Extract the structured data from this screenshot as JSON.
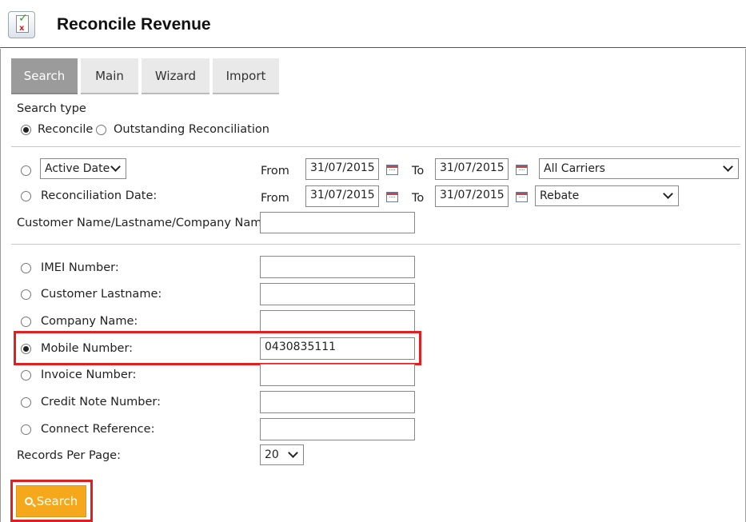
{
  "header": {
    "title": "Reconcile Revenue"
  },
  "tabs": [
    {
      "label": "Search",
      "active": true
    },
    {
      "label": "Main",
      "active": false
    },
    {
      "label": "Wizard",
      "active": false
    },
    {
      "label": "Import",
      "active": false
    }
  ],
  "search_type": {
    "label": "Search type",
    "options": [
      {
        "label": "Reconcile",
        "checked": true
      },
      {
        "label": "Outstanding Reconciliation",
        "checked": false
      }
    ]
  },
  "date_filters": {
    "active_date": {
      "select_value": "Active Date",
      "from_label": "From",
      "from_value": "31/07/2015",
      "to_label": "To",
      "to_value": "31/07/2015",
      "carrier_value": "All Carriers"
    },
    "reconciliation_date": {
      "label": "Reconciliation Date:",
      "from_label": "From",
      "from_value": "31/07/2015",
      "to_label": "To",
      "to_value": "31/07/2015",
      "type_value": "Rebate"
    }
  },
  "customer_name": {
    "label": "Customer Name/Lastname/Company Name:",
    "value": ""
  },
  "fields": [
    {
      "label": "IMEI Number:",
      "value": "",
      "checked": false
    },
    {
      "label": "Customer Lastname:",
      "value": "",
      "checked": false
    },
    {
      "label": "Company Name:",
      "value": "",
      "checked": false
    },
    {
      "label": "Mobile Number:",
      "value": "0430835111",
      "checked": true
    },
    {
      "label": "Invoice Number:",
      "value": "",
      "checked": false
    },
    {
      "label": "Credit Note Number:",
      "value": "",
      "checked": false
    },
    {
      "label": "Connect Reference:",
      "value": "",
      "checked": false
    }
  ],
  "records_per_page": {
    "label": "Records Per Page:",
    "value": "20"
  },
  "search_button": {
    "label": "Search"
  },
  "colors": {
    "accent": "#f5a81c",
    "highlight": "#e02020",
    "active_tab": "#9b9b9b"
  }
}
